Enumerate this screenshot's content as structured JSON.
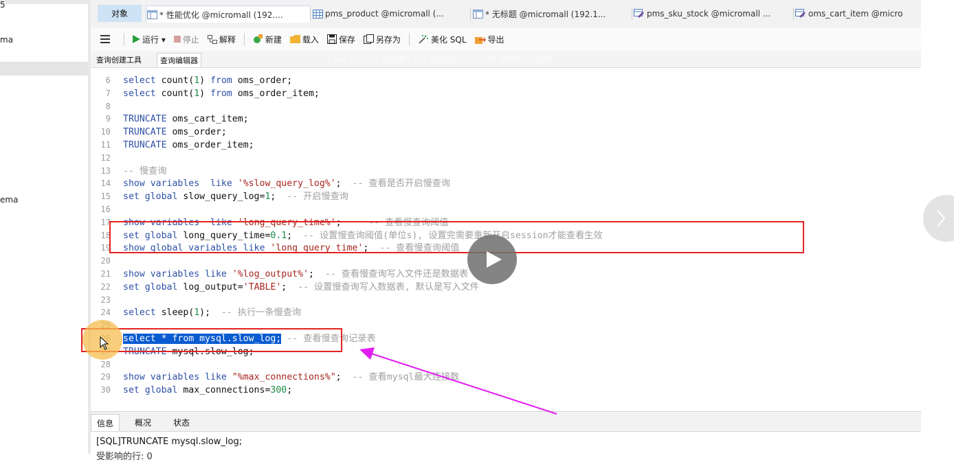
{
  "left_panel": {
    "items": [
      "5",
      "ma",
      "ema"
    ]
  },
  "tabs": {
    "object_label": "对象",
    "items": [
      {
        "label": "* 性能优化 @micromall (192...."
      },
      {
        "label": "pms_product @micromall (..."
      },
      {
        "label": "* 无标题 @micromall (192.1..."
      },
      {
        "label": "pms_sku_stock @micromall ..."
      },
      {
        "label": "oms_cart_item @micro"
      }
    ]
  },
  "toolbar": {
    "run": "运行 ▾",
    "stop": "停止",
    "explain": "解释",
    "new": "新建",
    "load": "载入",
    "save": "保存",
    "save_as": "另存为",
    "beautify": "美化 SQL",
    "export": "导出"
  },
  "subtabs": {
    "builder": "查询创建工具",
    "editor": "查询编辑器"
  },
  "watermark": "log.info（小白同学）- u_6060026020b8f_M00fqVtZMX",
  "code_lines": [
    {
      "n": "6",
      "parts": [
        [
          "kw",
          "select"
        ],
        [
          "id",
          " count("
        ],
        [
          "nm",
          "1"
        ],
        [
          "id",
          ") "
        ],
        [
          "kw",
          "from"
        ],
        [
          "id",
          " oms_order;"
        ]
      ]
    },
    {
      "n": "7",
      "parts": [
        [
          "kw",
          "select"
        ],
        [
          "id",
          " count("
        ],
        [
          "nm",
          "1"
        ],
        [
          "id",
          ") "
        ],
        [
          "kw",
          "from"
        ],
        [
          "id",
          " oms_order_item;"
        ]
      ]
    },
    {
      "n": "8",
      "parts": []
    },
    {
      "n": "9",
      "parts": [
        [
          "kw",
          "TRUNCATE"
        ],
        [
          "id",
          " oms_cart_item;"
        ]
      ]
    },
    {
      "n": "10",
      "parts": [
        [
          "kw",
          "TRUNCATE"
        ],
        [
          "id",
          " oms_order;"
        ]
      ]
    },
    {
      "n": "11",
      "parts": [
        [
          "kw",
          "TRUNCATE"
        ],
        [
          "id",
          " oms_order_item;"
        ]
      ]
    },
    {
      "n": "12",
      "parts": []
    },
    {
      "n": "13",
      "parts": [
        [
          "cm",
          "-- 慢查询"
        ]
      ]
    },
    {
      "n": "14",
      "parts": [
        [
          "kw",
          "show variables  like"
        ],
        [
          "id",
          " "
        ],
        [
          "st",
          "'%slow_query_log%'"
        ],
        [
          "id",
          ";  "
        ],
        [
          "cm",
          "-- 查看是否开启慢查询"
        ]
      ]
    },
    {
      "n": "15",
      "parts": [
        [
          "kw",
          "set global"
        ],
        [
          "id",
          " slow_query_log="
        ],
        [
          "nm",
          "1"
        ],
        [
          "id",
          ";  "
        ],
        [
          "cm",
          "-- 开启慢查询"
        ]
      ]
    },
    {
      "n": "16",
      "parts": []
    },
    {
      "n": "17",
      "parts": [
        [
          "kw",
          "show variables  like"
        ],
        [
          "id",
          " "
        ],
        [
          "st",
          "'long_query_time%'"
        ],
        [
          "id",
          ";     "
        ],
        [
          "cm",
          "-- 查看慢查询阈值"
        ]
      ]
    },
    {
      "n": "18",
      "parts": [
        [
          "kw",
          "set global"
        ],
        [
          "id",
          " long_query_time="
        ],
        [
          "nm",
          "0.1"
        ],
        [
          "id",
          ";  "
        ],
        [
          "cm",
          "-- 设置慢查询阈值(单位s), 设置完需要重新开启session才能查看生效"
        ]
      ]
    },
    {
      "n": "19",
      "parts": [
        [
          "kw",
          "show global variables like"
        ],
        [
          "id",
          " "
        ],
        [
          "st",
          "'long_query_time'"
        ],
        [
          "id",
          ";  "
        ],
        [
          "cm",
          "-- 查看慢查询阈值"
        ]
      ]
    },
    {
      "n": "20",
      "parts": []
    },
    {
      "n": "21",
      "parts": [
        [
          "kw",
          "show variables like"
        ],
        [
          "id",
          " "
        ],
        [
          "st",
          "'%log_output%'"
        ],
        [
          "id",
          ";  "
        ],
        [
          "cm",
          "-- 查看慢查询写入文件还是数据表"
        ]
      ]
    },
    {
      "n": "22",
      "parts": [
        [
          "kw",
          "set global"
        ],
        [
          "id",
          " log_output="
        ],
        [
          "st",
          "'TABLE'"
        ],
        [
          "id",
          ";  "
        ],
        [
          "cm",
          "-- 设置慢查询写入数据表, 默认是写入文件"
        ]
      ]
    },
    {
      "n": "23",
      "parts": []
    },
    {
      "n": "24",
      "parts": [
        [
          "kw",
          "select"
        ],
        [
          "id",
          " sleep("
        ],
        [
          "nm",
          "1"
        ],
        [
          "id",
          ");  "
        ],
        [
          "cm",
          "-- 执行一条慢查询"
        ]
      ]
    },
    {
      "n": "25",
      "parts": []
    },
    {
      "n": "26",
      "parts": [
        [
          "sel",
          "select * from mysql.slow_log;"
        ],
        [
          "id",
          " "
        ],
        [
          "cm",
          "-- 查看慢查询记录表"
        ]
      ]
    },
    {
      "n": "27",
      "parts": [
        [
          "kw",
          "TRUNCATE"
        ],
        [
          "id",
          " mysql.slow_log;"
        ]
      ]
    },
    {
      "n": "28",
      "parts": []
    },
    {
      "n": "29",
      "parts": [
        [
          "kw",
          "show variables like"
        ],
        [
          "id",
          " "
        ],
        [
          "st",
          "\"%max_connections%\""
        ],
        [
          "id",
          ";  "
        ],
        [
          "cm",
          "-- 查看mysql最大连接数"
        ]
      ]
    },
    {
      "n": "30",
      "parts": [
        [
          "kw",
          "set global"
        ],
        [
          "id",
          " max_connections="
        ],
        [
          "nm",
          "300"
        ],
        [
          "id",
          ";"
        ]
      ]
    }
  ],
  "bottom_tabs": {
    "info": "信息",
    "overview": "概况",
    "status": "状态"
  },
  "info": {
    "line1": "[SQL]TRUNCATE mysql.slow_log;",
    "line2": "受影响的行: 0"
  },
  "colors": {
    "highlight_box": "#e2221f",
    "arrow": "#e01cf0",
    "selection": "#0a5bd1"
  }
}
